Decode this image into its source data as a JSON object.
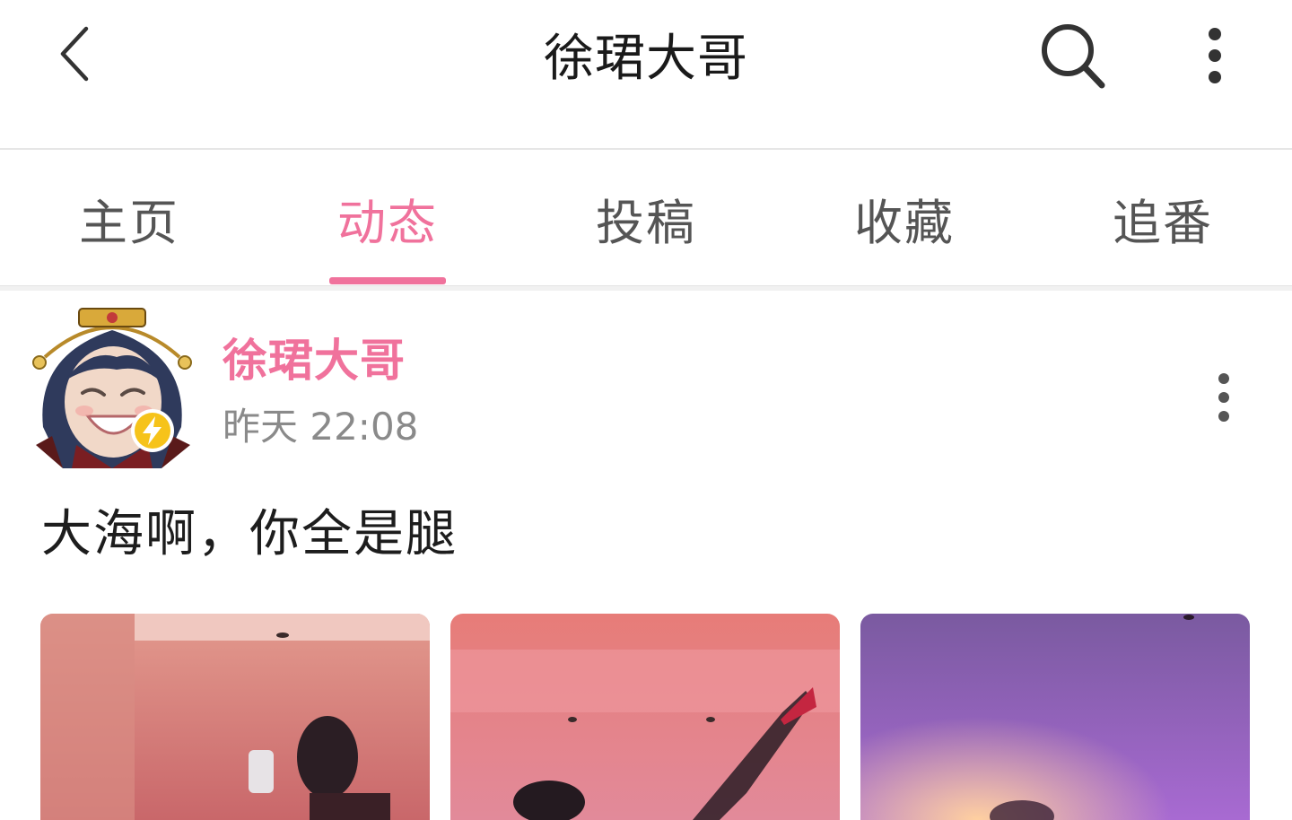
{
  "header": {
    "title": "徐珺大哥",
    "back_icon": "chevron-left-icon",
    "search_icon": "search-icon",
    "more_icon": "more-vertical-icon"
  },
  "tabs": [
    {
      "label": "主页",
      "active": false
    },
    {
      "label": "动态",
      "active": true
    },
    {
      "label": "投稿",
      "active": false
    },
    {
      "label": "收藏",
      "active": false
    },
    {
      "label": "追番",
      "active": false
    }
  ],
  "post": {
    "author": "徐珺大哥",
    "time": "昨天 22:08",
    "text": "大海啊，你全是腿",
    "badge_icon": "lightning-badge-icon",
    "more_icon": "more-vertical-icon",
    "images": [
      "post-image-1",
      "post-image-2",
      "post-image-3"
    ]
  },
  "colors": {
    "accent": "#f0729c",
    "text_primary": "#1a1a1a",
    "text_secondary": "#8a8a8a",
    "tab_inactive": "#555555",
    "divider": "#e6e6e6"
  }
}
